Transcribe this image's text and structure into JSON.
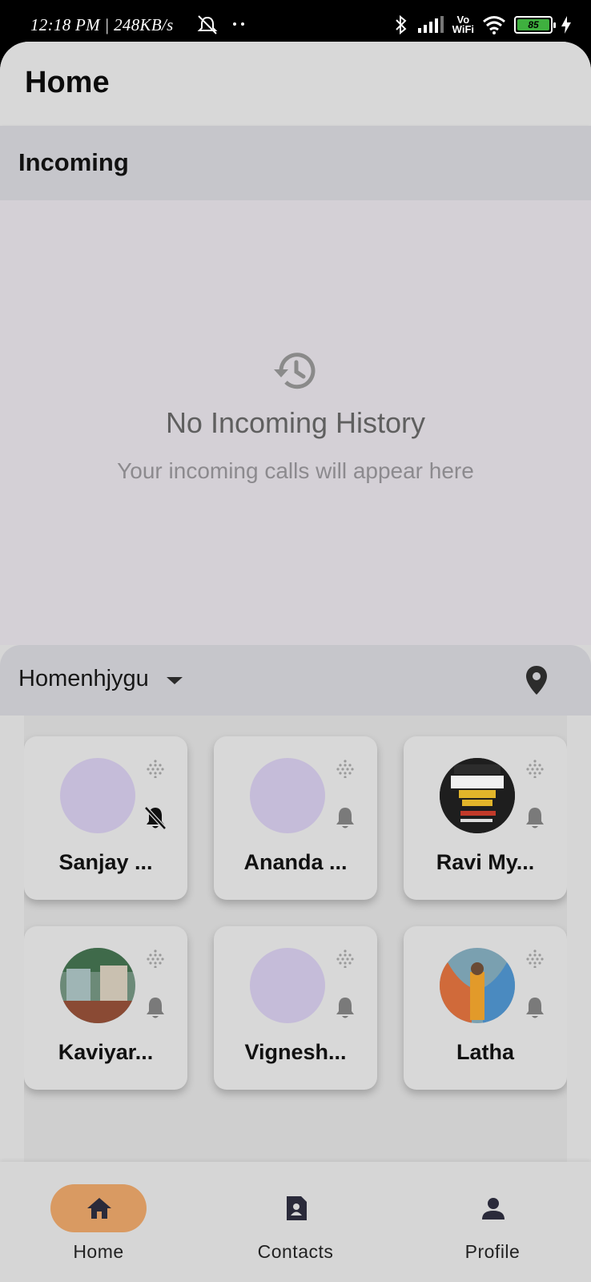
{
  "status": {
    "time_speed": "12:18 PM | 248KB/s",
    "vowifi_top": "Vo",
    "vowifi_bottom": "WiFi",
    "battery": "85",
    "icons": [
      "mute-icon",
      "bluetooth-icon",
      "signal-icon",
      "wifi-icon",
      "battery-icon",
      "charging-icon"
    ]
  },
  "appbar": {
    "title": "Home"
  },
  "incoming": {
    "title": "Incoming",
    "empty_icon": "history-icon",
    "empty_title": "No Incoming History",
    "empty_subtitle": "Your incoming calls will appear here"
  },
  "location": {
    "name": "Homenhjygu",
    "icon": "location-pin-icon"
  },
  "contacts": [
    {
      "name": "Sanjay ...",
      "avatar": "placeholder",
      "muted": true
    },
    {
      "name": "Ananda ...",
      "avatar": "placeholder",
      "muted": false
    },
    {
      "name": "Ravi My...",
      "avatar": "photo",
      "muted": false
    },
    {
      "name": "Kaviyar...",
      "avatar": "photo",
      "muted": false
    },
    {
      "name": "Vignesh...",
      "avatar": "placeholder",
      "muted": false
    },
    {
      "name": "Latha",
      "avatar": "photo",
      "muted": false
    }
  ],
  "nav": {
    "items": [
      {
        "label": "Home",
        "icon": "home-icon",
        "active": true
      },
      {
        "label": "Contacts",
        "icon": "contact-card-icon",
        "active": false
      },
      {
        "label": "Profile",
        "icon": "person-icon",
        "active": false
      }
    ]
  },
  "colors": {
    "accent": "#d99a62",
    "avatar_placeholder": "#c5bcd9"
  }
}
